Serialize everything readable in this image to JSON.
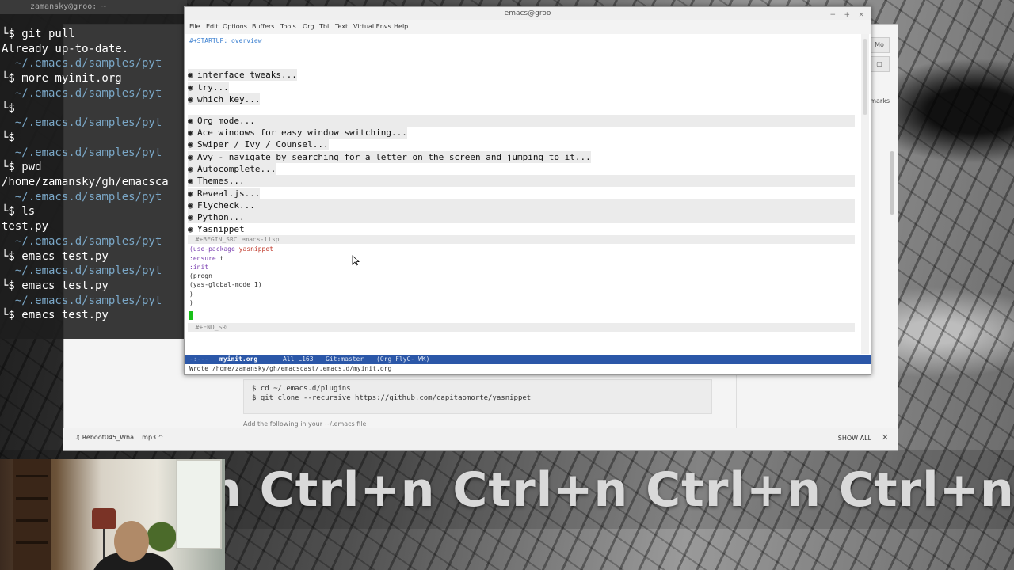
{
  "terminal": {
    "title": "zamansky@groo: ~",
    "lines": [
      {
        "kind": "cmd",
        "text": "└$ git pull"
      },
      {
        "kind": "out",
        "text": "Already up-to-date."
      },
      {
        "kind": "path",
        "text": "  ~/.emacs.d/samples/pyt"
      },
      {
        "kind": "cmd",
        "text": "└$ more myinit.org"
      },
      {
        "kind": "path",
        "text": "  ~/.emacs.d/samples/pyt"
      },
      {
        "kind": "cmd",
        "text": "└$"
      },
      {
        "kind": "path",
        "text": "  ~/.emacs.d/samples/pyt"
      },
      {
        "kind": "cmd",
        "text": "└$"
      },
      {
        "kind": "path",
        "text": "  ~/.emacs.d/samples/pyt"
      },
      {
        "kind": "cmd",
        "text": "└$ pwd"
      },
      {
        "kind": "out",
        "text": "/home/zamansky/gh/emacsca"
      },
      {
        "kind": "path",
        "text": "  ~/.emacs.d/samples/pyt"
      },
      {
        "kind": "cmd",
        "text": "└$ ls"
      },
      {
        "kind": "out",
        "text": "test.py"
      },
      {
        "kind": "path",
        "text": "  ~/.emacs.d/samples/pyt"
      },
      {
        "kind": "cmd",
        "text": "└$ emacs test.py"
      },
      {
        "kind": "path",
        "text": "  ~/.emacs.d/samples/pyt"
      },
      {
        "kind": "cmd",
        "text": "└$ emacs test.py"
      },
      {
        "kind": "path",
        "text": "  ~/.emacs.d/samples/pyt"
      },
      {
        "kind": "cmd",
        "text": "└$ emacs test.py"
      }
    ]
  },
  "emacs": {
    "title": "emacs@groo",
    "window_buttons": [
      "−",
      "+",
      "×"
    ],
    "menu": [
      "File",
      "Edit",
      "Options",
      "Buffers",
      "Tools",
      "Org",
      "Tbl",
      "Text",
      "Virtual Envs",
      "Help"
    ],
    "startup_line": "#+STARTUP: overview",
    "headings_group1": [
      "interface tweaks...",
      "try...",
      "which key..."
    ],
    "headings_group2": [
      "Org mode...",
      "Ace windows for easy window switching...",
      "Swiper / Ivy / Counsel...",
      "Avy - navigate by searching for a letter on the screen and jumping to it...",
      "Autocomplete...",
      "Themes...",
      "Reveal.js...",
      "Flycheck...",
      "Python...",
      "Yasnippet"
    ],
    "begin_src": "#+BEGIN_SRC emacs-lisp",
    "src": {
      "l1_kw": "(use-package ",
      "l1_str": "yasnippet",
      "l2_kw": ":ensure",
      "l2_rest": " t",
      "l3_kw": ":init",
      "l4": "(progn",
      "l5": "(yas-global-mode 1)",
      "l6": ")",
      "l7": ")"
    },
    "end_src": "#+END_SRC",
    "modeline": {
      "status": "-:---",
      "buffer": "myinit.org",
      "position": "All L163",
      "vc": "Git:master",
      "modes": "(Org FlyC- WK)"
    },
    "minibuffer": "Wrote /home/zamansky/gh/emacscast/.emacs.d/myinit.org"
  },
  "browser": {
    "buttons": [
      "Mo",
      "▢"
    ],
    "bookmarks_label": "marks",
    "code_lines": [
      "$ cd ~/.emacs.d/plugins",
      "$ git clone --recursive https://github.com/capitaomorte/yasnippet"
    ],
    "partial_text": "Add the following in your ~/.emacs file",
    "download_item": "Reboot045_Wha....mp3",
    "show_all": "SHOW ALL",
    "close": "✕"
  },
  "keycast": "n Ctrl+n Ctrl+n Ctrl+n Ctrl+n"
}
